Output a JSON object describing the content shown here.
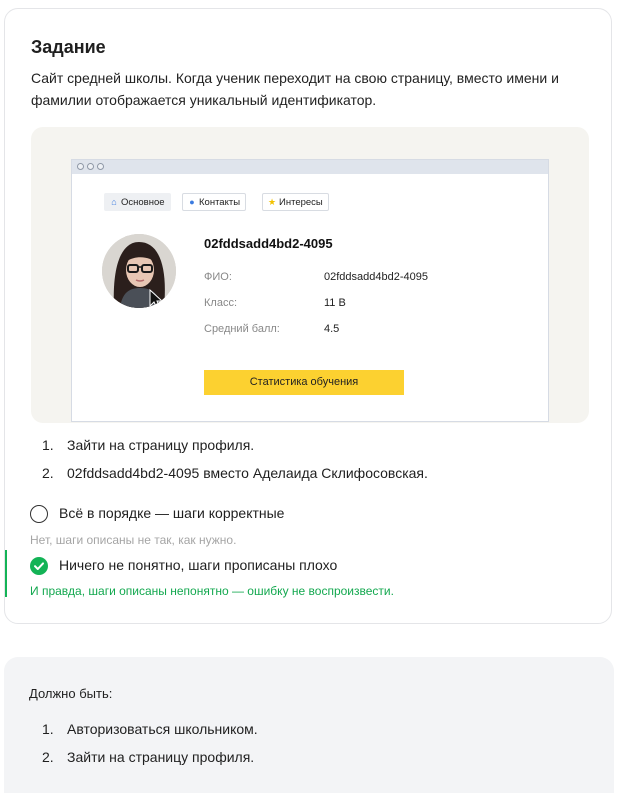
{
  "task": {
    "title": "Задание",
    "description": "Сайт средней школы. Когда ученик переходит на свою страницу, вместо имени и фамилии отображается уникальный идентификатор."
  },
  "profile_mock": {
    "tabs": [
      {
        "label": "Основное",
        "icon": "home-icon"
      },
      {
        "label": "Контакты",
        "icon": "person-icon"
      },
      {
        "label": "Интересы",
        "icon": "star-icon"
      }
    ],
    "id_heading": "02fddsadd4bd2-4095",
    "fields": [
      {
        "label": "ФИО:",
        "value": "02fddsadd4bd2-4095"
      },
      {
        "label": "Класс:",
        "value": "11 В"
      },
      {
        "label": "Средний балл:",
        "value": "4.5"
      }
    ],
    "stats_button": "Статистика обучения"
  },
  "steps": [
    {
      "num": "1.",
      "text": "Зайти на страницу профиля."
    },
    {
      "num": "2.",
      "text": "02fddsadd4bd2-4095 вместо Аделаида Склифосовская."
    }
  ],
  "options": [
    {
      "label": "Всё в порядке — шаги корректные",
      "hint": "Нет, шаги описаны не так, как нужно.",
      "selected": false
    },
    {
      "label": "Ничего не понятно, шаги прописаны плохо",
      "hint": "И правда, шаги описаны непонятно — ошибку не воспроизвести.",
      "selected": true
    }
  ],
  "expected": {
    "title": "Должно быть:",
    "steps": [
      {
        "num": "1.",
        "text": "Авторизоваться школьником."
      },
      {
        "num": "2.",
        "text": "Зайти на страницу профиля."
      }
    ]
  },
  "colors": {
    "accent_green": "#13b356",
    "button_yellow": "#fcd130",
    "panel_bg": "#f3f4f6"
  }
}
